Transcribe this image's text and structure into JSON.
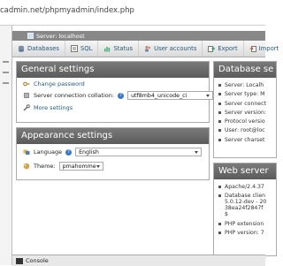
{
  "browser": {
    "url": "cadmin.net/phpmyadmin/index.php"
  },
  "breadcrumb": {
    "label": "Server: localhost"
  },
  "tabs": [
    {
      "label": "Databases",
      "icon": "database-icon"
    },
    {
      "label": "SQL",
      "icon": "sql-icon"
    },
    {
      "label": "Status",
      "icon": "status-icon"
    },
    {
      "label": "User accounts",
      "icon": "users-icon"
    },
    {
      "label": "Export",
      "icon": "export-icon"
    },
    {
      "label": "Import",
      "icon": "import-icon"
    }
  ],
  "general": {
    "title": "General settings",
    "change_password": "Change password",
    "collation_label": "Server connection collation:",
    "collation_value": "utf8mb4_unicode_ci",
    "more_settings": "More settings"
  },
  "appearance": {
    "title": "Appearance settings",
    "language_label": "Language",
    "language_value": "English",
    "theme_label": "Theme:",
    "theme_value": "pmahomme"
  },
  "database_server": {
    "title": "Database se",
    "items": [
      "Server: Localh",
      "Server type: M",
      "Server connect",
      "Server version:",
      "Protocol versio",
      "User: root@loc",
      "Server charset"
    ]
  },
  "web_server": {
    "title": "Web server",
    "items": [
      "Apache/2.4.37",
      "Database clien",
      "5.0.12-dev - 20",
      "38ea24f2847f",
      "$",
      "PHP extension",
      "PHP version: 7"
    ]
  },
  "console": {
    "label": "Console"
  },
  "colors": {
    "header_bg": "#5b5b5b",
    "link": "#235a81",
    "breadcrumb_bg": "#888888"
  }
}
